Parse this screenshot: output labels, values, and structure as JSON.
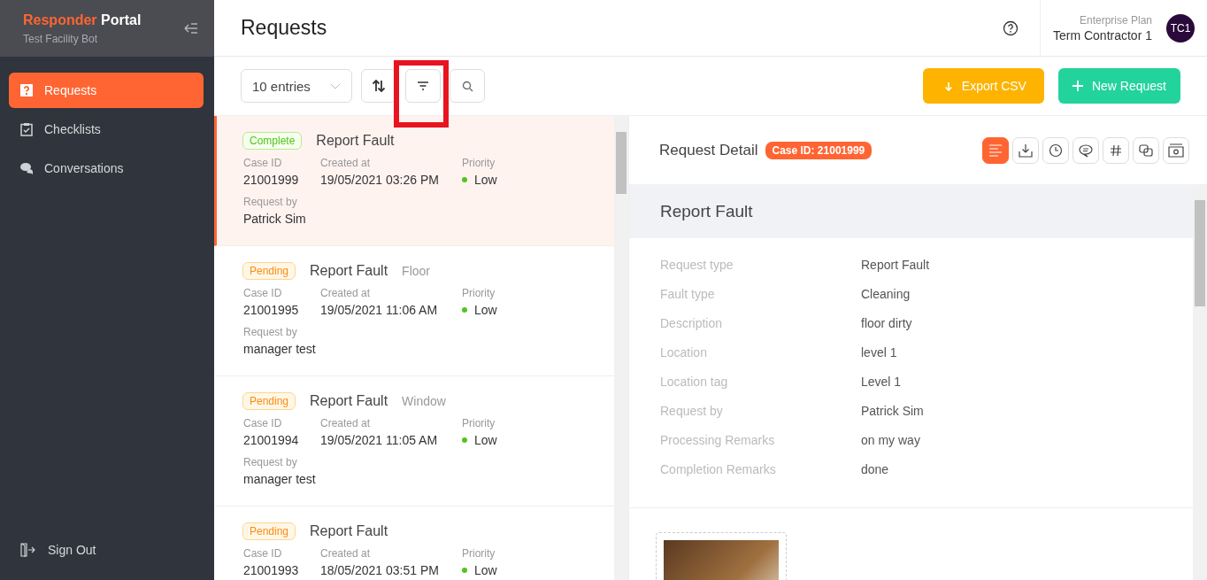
{
  "sidebar": {
    "brand_first": "Responder",
    "brand_second": "Portal",
    "subtitle": "Test Facility Bot",
    "items": [
      {
        "label": "Requests",
        "kind": "question",
        "selected": true
      },
      {
        "label": "Checklists",
        "kind": "clipboard",
        "selected": false
      },
      {
        "label": "Conversations",
        "kind": "chat",
        "selected": false
      }
    ],
    "sign_out": "Sign Out"
  },
  "header": {
    "title": "Requests",
    "plan": "Enterprise Plan",
    "user": "Term Contractor 1",
    "avatar": "TC1"
  },
  "toolbar": {
    "entries": "10 entries",
    "tools": [
      {
        "kind": "sort",
        "highlighted": false
      },
      {
        "kind": "filter",
        "highlighted": true
      },
      {
        "kind": "search",
        "highlighted": false
      }
    ],
    "export": "Export CSV",
    "new": "New Request"
  },
  "requests": [
    {
      "status": "Complete",
      "kind": "complete",
      "title": "Report Fault",
      "selected": true,
      "case_label": "Case ID",
      "case_id": "21001999",
      "created_label": "Created at",
      "created": "19/05/2021 03:26 PM",
      "priority_label": "Priority",
      "priority": "Low",
      "color": "#52c41a",
      "request_by_label": "Request by",
      "request_by": "Patrick Sim"
    },
    {
      "status": "Pending",
      "kind": "pending",
      "title": "Report Fault",
      "subtype": "Floor",
      "selected": false,
      "case_label": "Case ID",
      "case_id": "21001995",
      "created_label": "Created at",
      "created": "19/05/2021 11:06 AM",
      "priority_label": "Priority",
      "priority": "Low",
      "color": "#52c41a",
      "request_by_label": "Request by",
      "request_by": "manager test"
    },
    {
      "status": "Pending",
      "kind": "pending",
      "title": "Report Fault",
      "subtype": "Window",
      "selected": false,
      "case_label": "Case ID",
      "case_id": "21001994",
      "created_label": "Created at",
      "created": "19/05/2021 11:05 AM",
      "priority_label": "Priority",
      "priority": "Low",
      "color": "#52c41a",
      "request_by_label": "Request by",
      "request_by": "manager test"
    },
    {
      "status": "Pending",
      "kind": "pending",
      "title": "Report Fault",
      "selected": false,
      "case_label": "Case ID",
      "case_id": "21001993",
      "created_label": "Created at",
      "created": "18/05/2021 03:51 PM",
      "priority_label": "Priority",
      "priority": "Low",
      "color": "#52c41a"
    }
  ],
  "detail": {
    "title": "Request Detail",
    "case_badge": "Case ID: 21001999",
    "tabs": [
      {
        "kind": "details",
        "selected": true
      },
      {
        "kind": "download",
        "selected": false
      },
      {
        "kind": "history",
        "selected": false
      },
      {
        "kind": "comments",
        "selected": false
      },
      {
        "kind": "hash",
        "selected": false
      },
      {
        "kind": "copy",
        "selected": false
      },
      {
        "kind": "photo",
        "selected": false
      }
    ],
    "heading": "Report Fault",
    "fields": [
      {
        "label": "Request type",
        "value": "Report Fault"
      },
      {
        "label": "Fault type",
        "value": "Cleaning"
      },
      {
        "label": "Description",
        "value": "floor dirty"
      },
      {
        "label": "Location",
        "value": "level 1"
      },
      {
        "label": "Location tag",
        "value": "Level 1"
      },
      {
        "label": "Request by",
        "value": "Patrick Sim"
      },
      {
        "label": "Processing Remarks",
        "value": "on my way"
      },
      {
        "label": "Completion Remarks",
        "value": "done"
      }
    ]
  }
}
